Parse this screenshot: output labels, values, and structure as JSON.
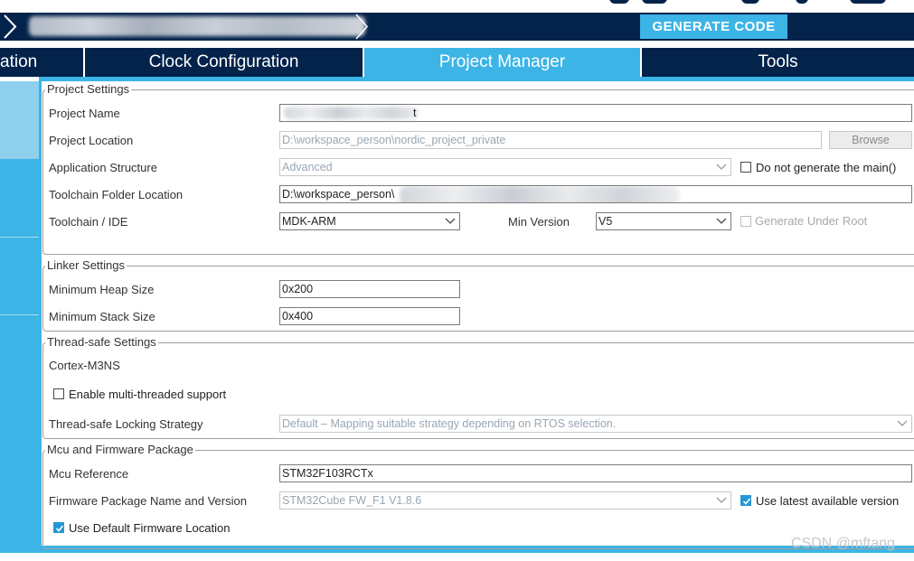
{
  "header": {
    "generate_label": "GENERATE CODE"
  },
  "tabs": [
    {
      "label": "ation"
    },
    {
      "label": "Clock Configuration"
    },
    {
      "label": "Project Manager"
    },
    {
      "label": "Tools"
    }
  ],
  "project_settings": {
    "legend": "Project Settings",
    "project_name_label": "Project Name",
    "project_name_value": "t",
    "project_location_label": "Project Location",
    "project_location_value": "D:\\workspace_person\\nordic_project_private",
    "browse_label": "Browse",
    "app_structure_label": "Application Structure",
    "app_structure_value": "Advanced",
    "no_main_label": "Do not generate the main()",
    "toolchain_folder_label": "Toolchain Folder Location",
    "toolchain_folder_value": "D:\\workspace_person\\",
    "toolchain_ide_label": "Toolchain / IDE",
    "toolchain_ide_value": "MDK-ARM",
    "min_version_label": "Min Version",
    "min_version_value": "V5",
    "generate_under_root_label": "Generate Under Root"
  },
  "linker_settings": {
    "legend": "Linker Settings",
    "heap_label": "Minimum Heap Size",
    "heap_value": "0x200",
    "stack_label": "Minimum Stack Size",
    "stack_value": "0x400"
  },
  "thread_safe": {
    "legend": "Thread-safe Settings",
    "core_label": "Cortex-M3NS",
    "multithread_label": "Enable multi-threaded support",
    "strategy_label": "Thread-safe Locking Strategy",
    "strategy_value": "Default – Mapping suitable strategy depending on RTOS selection."
  },
  "mcu_firmware": {
    "legend": "Mcu and Firmware Package",
    "mcu_ref_label": "Mcu Reference",
    "mcu_ref_value": "STM32F103RCTx",
    "fw_label": "Firmware Package Name and Version",
    "fw_value": "STM32Cube FW_F1 V1.8.6",
    "use_latest_label": "Use latest available version",
    "use_default_label": "Use Default Firmware Location"
  },
  "watermark": "CSDN @mftang",
  "colors": {
    "navy": "#03234b",
    "accent": "#3cb4e6",
    "checkbox_on": "#2596d6"
  }
}
